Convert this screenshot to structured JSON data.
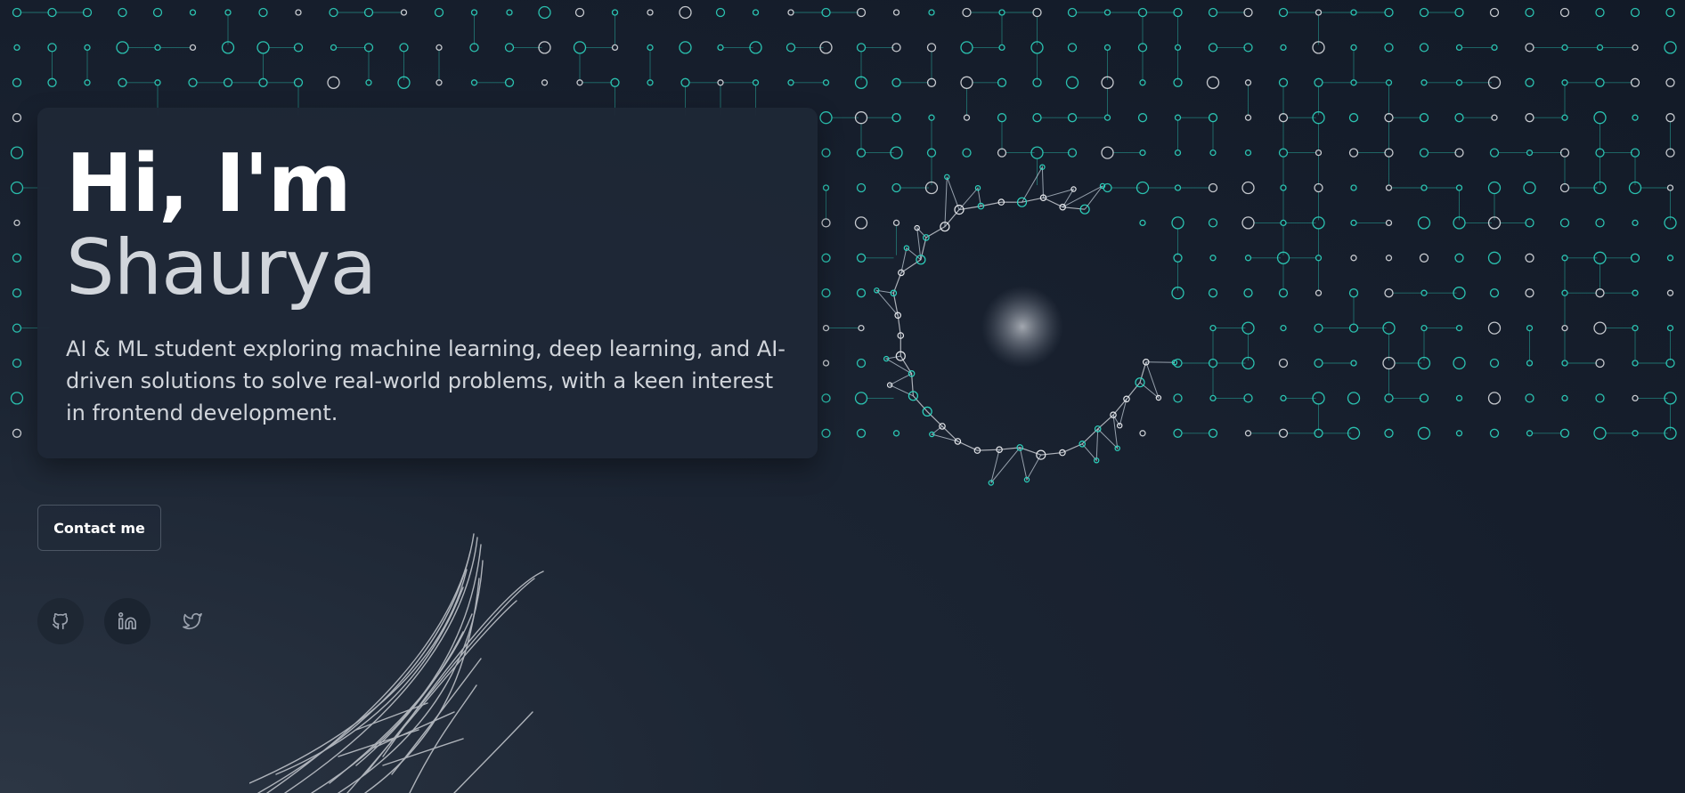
{
  "hero": {
    "greeting": "Hi, I'm",
    "name": "Shaurya",
    "bio": "AI & ML student exploring machine learning, deep learning, and AI-driven solutions to solve real-world problems, with a keen interest in frontend development."
  },
  "contact_button": {
    "label": "Contact me"
  },
  "social_links": [
    {
      "icon": "github-icon"
    },
    {
      "icon": "linkedin-icon"
    },
    {
      "icon": "twitter-icon"
    }
  ],
  "colors": {
    "accent": "#2dd4bf",
    "node_white": "#e5e7eb",
    "background": "#161e2c",
    "card": "#1e2836"
  }
}
